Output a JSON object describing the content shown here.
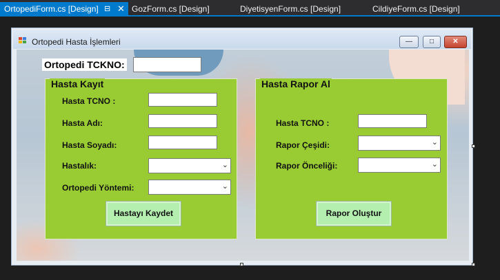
{
  "ide": {
    "tabs": [
      {
        "label": "OrtopediForm.cs [Design]",
        "active": true
      },
      {
        "label": "GozForm.cs [Design]"
      },
      {
        "label": "DiyetisyenForm.cs [Design]"
      },
      {
        "label": "CildiyeForm.cs [Design]"
      }
    ],
    "pin_glyph": "⊟",
    "close_glyph": "✕"
  },
  "form": {
    "title": "Ortopedi Hasta İşlemleri",
    "window_buttons": {
      "minimize": "—",
      "maximize": "□",
      "close": "✕"
    },
    "tckno_label": "Ortopedi TCKNO:",
    "tckno_value": ""
  },
  "hasta_kayit": {
    "title": "Hasta Kayıt",
    "tcno_label": "Hasta TCNO :",
    "adi_label": "Hasta Adı:",
    "soyadi_label": "Hasta Soyadı:",
    "hastalik_label": "Hastalık:",
    "yontem_label": "Ortopedi Yöntemi:",
    "tcno_value": "",
    "adi_value": "",
    "soyadi_value": "",
    "hastalik_value": "",
    "yontem_value": "",
    "kaydet_button": "Hastayı Kaydet"
  },
  "hasta_rapor": {
    "title": "Hasta Rapor Al",
    "tcno_label": "Hasta TCNO :",
    "cesit_label": "Rapor Çeşidi:",
    "oncelik_label": "Rapor Önceliği:",
    "tcno_value": "",
    "cesit_value": "",
    "oncelik_value": "",
    "olustur_button": "Rapor Oluştur"
  },
  "colors": {
    "accent": "#007acc",
    "group_green": "#99cc33",
    "button_green": "#b5efb0",
    "ide_background": "#1e1e1e"
  },
  "icons": {
    "combo_arrow": "⌄"
  }
}
